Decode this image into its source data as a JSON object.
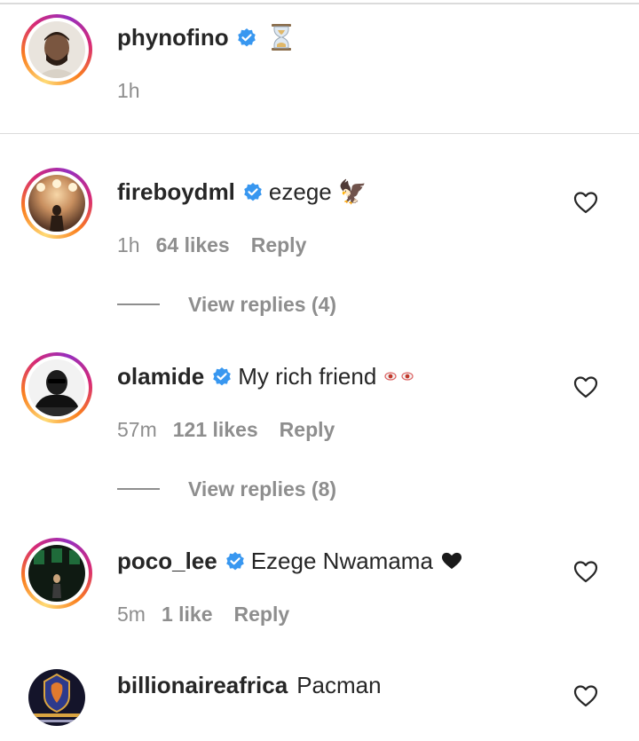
{
  "caption": {
    "username": "phynofino",
    "emoji": "hourglass",
    "time": "1h"
  },
  "comments": [
    {
      "username": "fireboydml",
      "text": "ezege 🦅",
      "time": "1h",
      "likes": "64 likes",
      "reply": "Reply",
      "view_replies": "View replies (4)"
    },
    {
      "username": "olamide",
      "text": "My rich friend",
      "emoji": "eyes",
      "time": "57m",
      "likes": "121 likes",
      "reply": "Reply",
      "view_replies": "View replies (8)"
    },
    {
      "username": "poco_lee",
      "text": "Ezege Nwamama",
      "emoji": "heart",
      "time": "5m",
      "likes": "1 like",
      "reply": "Reply"
    },
    {
      "username": "billionaireafrica",
      "text": "Pacman"
    }
  ],
  "colors": {
    "verified": "#3897f0",
    "meta_text": "#8e8e8e",
    "primary_text": "#262626"
  }
}
